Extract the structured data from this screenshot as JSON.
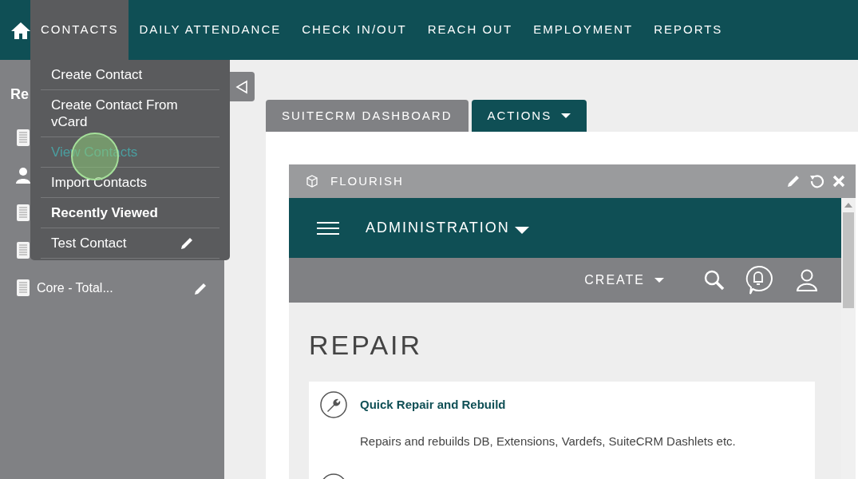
{
  "nav": {
    "items": [
      {
        "label": "CONTACTS",
        "selected": true
      },
      {
        "label": "DAILY ATTENDANCE",
        "selected": false
      },
      {
        "label": "CHECK IN/OUT",
        "selected": false
      },
      {
        "label": "REACH OUT",
        "selected": false
      },
      {
        "label": "EMPLOYMENT",
        "selected": false
      },
      {
        "label": "REPORTS",
        "selected": false
      }
    ]
  },
  "dropdown": {
    "items": [
      {
        "kind": "link",
        "label": "Create Contact",
        "highlighted": false
      },
      {
        "kind": "link",
        "label": "Create Contact From vCard",
        "highlighted": false
      },
      {
        "kind": "link",
        "label": "View Contacts",
        "highlighted": true
      },
      {
        "kind": "link",
        "label": "Import Contacts",
        "highlighted": false
      },
      {
        "kind": "header",
        "label": "Recently Viewed"
      },
      {
        "kind": "recent",
        "label": "Test Contact"
      }
    ]
  },
  "sidebar": {
    "title": "Re",
    "items": [
      {
        "kind": "document"
      },
      {
        "kind": "person"
      },
      {
        "kind": "document"
      },
      {
        "kind": "document"
      },
      {
        "kind": "document",
        "label": "Core - Total..."
      }
    ]
  },
  "tabs": [
    {
      "label": "SUITECRM DASHBOARD",
      "selected": false
    },
    {
      "label": "ACTIONS",
      "selected": true
    }
  ],
  "dashlet": {
    "title": "FLOURISH",
    "app": {
      "menu": "ADMINISTRATION",
      "create": "CREATE",
      "heading": "REPAIR",
      "items": [
        {
          "kind": "tool",
          "title": "Quick Repair and Rebuild",
          "description": "Repairs and rebuilds DB, Extensions, Vardefs, SuiteCRM Dashlets etc."
        },
        {
          "kind": "tool"
        }
      ]
    }
  }
}
